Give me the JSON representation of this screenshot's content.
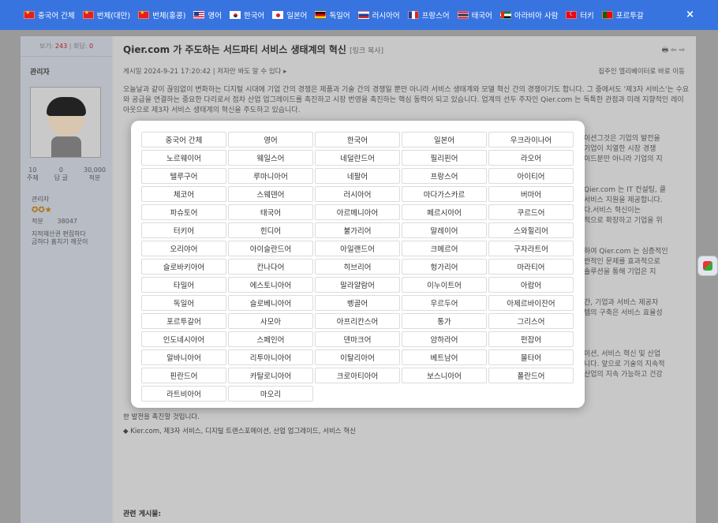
{
  "topbar": {
    "languages": [
      {
        "label": "중국어 간체",
        "flag": "cn"
      },
      {
        "label": "번체(대만)",
        "flag": "cn"
      },
      {
        "label": "번체(홍콩)",
        "flag": "cn"
      },
      {
        "label": "영어",
        "flag": "us"
      },
      {
        "label": "한국어",
        "flag": "kr"
      },
      {
        "label": "일본어",
        "flag": "jp"
      },
      {
        "label": "독일어",
        "flag": "de"
      },
      {
        "label": "러시아어",
        "flag": "ru"
      },
      {
        "label": "프랑스어",
        "flag": "fr"
      },
      {
        "label": "태국어",
        "flag": "th"
      },
      {
        "label": "아라비아 사람",
        "flag": "ae"
      },
      {
        "label": "터키",
        "flag": "tr"
      },
      {
        "label": "포르투갈",
        "flag": "pt"
      }
    ],
    "close_label": "×",
    "accent_color": "#3874e0"
  },
  "sidebar": {
    "views_label": "보기:",
    "views_value": "243",
    "replies_label": "회답:",
    "replies_value": "0",
    "author": "관리자",
    "stats": [
      {
        "value": "10",
        "label": "주제"
      },
      {
        "value": "0",
        "label": "답 글"
      },
      {
        "value": "30,000",
        "label": "적분"
      }
    ],
    "role": "관리자",
    "stars": "✪✪★",
    "points_label": "적분",
    "points_value": "38047",
    "note": "지적재산권 편집하다",
    "note2": "금하다 훔치기 깨끗이"
  },
  "post": {
    "title": "Qier.com 가 주도하는 서드파티 서비스 생태계의 혁신",
    "copy_link": "[링크 복사]",
    "toolbar_icons": "🖶 ⇦ ⇨",
    "meta": "게시일 2024-9-21 17:20:42  |  저자만 봐도 알 수 있다 ▸",
    "meta_right": "집주인   엘리베이터로 바로 이동",
    "para1": "오늘날과 같이 끊임없이 변화하는 디지털 시대에 기업 간의 경쟁은 제품과 기술 간의 경쟁일 뿐만 아니라 서비스 생태계와 모델 혁신 간의 경쟁이기도 합니다. 그 중에서도 '제3자 서비스'는 수요와 공급을 연결하는 중요한 다리로서 점차 산업 업그레이드를 촉진하고 시장 번영을 촉진하는 핵심 동력이 되고 있습니다. 업계의 선두 주자인 Qier.com 는 독특한 관점과 미래 지향적인 레이아웃으로 제3자 서비스 생태계의 혁신을 주도하고 있습니다.",
    "right_lines": [
      "이션그것은 기업의 발전을",
      "기업이 치열한 시장 경쟁",
      "이드분만 아니라 기업의 지",
      "",
      "",
      "Qier.com 는 IT 컨설팅, 클",
      "서비스 지원을 제공합니다.",
      "다.서비스 혁신이는",
      "적으로 확장하고 기업을 위",
      "",
      "",
      "하여 Qier.com 는 심층적인",
      "반적인 문제를 효과적으로",
      "솔루션을 통해 기업은 지",
      "",
      "",
      "간, 기업과 서비스 제공자",
      "템의 구축은 서비스 효율성",
      "",
      "",
      "",
      "이션, 서비스 혁신 및 산업",
      "니다. 앞으로 기술의 지속적",
      "산업의 지속 가능하고 건강"
    ],
    "closing": "한 발전을 촉진할 것입니다.",
    "tags": "Kier.com, 제3자 서비스, 디지털 트랜스포메이션, 산업 업그레이드, 서비스 혁신",
    "related": "관련 게시물:"
  },
  "modal": {
    "languages": [
      "중국어 간체",
      "영어",
      "한국어",
      "일본어",
      "우크라이나어",
      "노르웨이어",
      "웨일스어",
      "네덜란드어",
      "필리핀어",
      "라오어",
      "텔루구어",
      "루마니아어",
      "네팔어",
      "프랑스어",
      "아이티어",
      "체코어",
      "스웨덴어",
      "러시아어",
      "마다가스카르",
      "버마어",
      "파슈토어",
      "태국어",
      "아르메니아어",
      "페르시아어",
      "쿠르드어",
      "터키어",
      "힌디어",
      "불가리어",
      "말레이어",
      "스와힐리어",
      "오리야어",
      "아이슬란드어",
      "아일랜드어",
      "크메르어",
      "구자라트어",
      "슬로바키아어",
      "칸나다어",
      "히브리어",
      "헝가리어",
      "마라티어",
      "타밀어",
      "에스토니아어",
      "말라얄람어",
      "이누이트어",
      "아랍어",
      "독일어",
      "슬로베니아어",
      "벵골어",
      "우르두어",
      "아제르바이잔어",
      "포르투갈어",
      "사모아",
      "아프리칸스어",
      "통가",
      "그리스어",
      "인도네시아어",
      "스페인어",
      "덴마크어",
      "암하라어",
      "펀잡어",
      "알바니아어",
      "리투아니아어",
      "이탈리아어",
      "베트남어",
      "몰타어",
      "핀란드어",
      "카탈로니아어",
      "크로아티아어",
      "보스니아어",
      "폴란드어",
      "라트비아어",
      "마오리"
    ]
  }
}
